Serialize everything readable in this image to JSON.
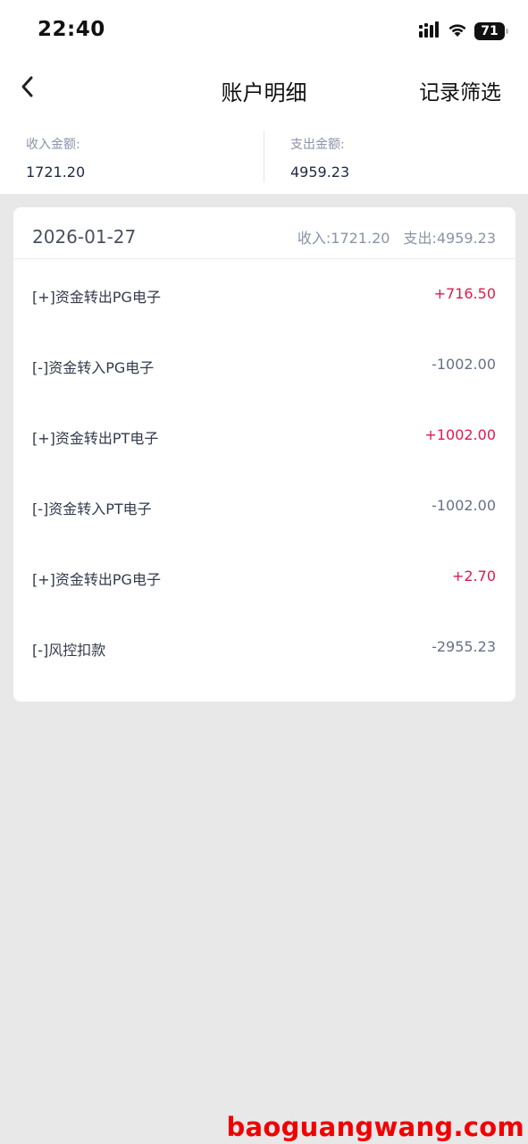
{
  "status_bar": {
    "time": "22:40",
    "battery": "71",
    "icons": [
      "signal-icon",
      "wifi-icon",
      "battery-icon"
    ]
  },
  "nav": {
    "back_icon": "chevron-left-icon",
    "title": "账户明细",
    "filter_label": "记录筛选"
  },
  "summary": {
    "income_label": "收入金额:",
    "income_value": "1721.20",
    "expense_label": "支出金额:",
    "expense_value": "4959.23"
  },
  "group": {
    "date": "2026-01-27",
    "income_total": "收入:1721.20",
    "expense_total": "支出:4959.23",
    "records": [
      {
        "label": "[+]资金转出PG电子",
        "amount": "+716.50",
        "type": "pos"
      },
      {
        "label": "[-]资金转入PG电子",
        "amount": "-1002.00",
        "type": "neg"
      },
      {
        "label": "[+]资金转出PT电子",
        "amount": "+1002.00",
        "type": "pos"
      },
      {
        "label": "[-]资金转入PT电子",
        "amount": "-1002.00",
        "type": "neg"
      },
      {
        "label": "[+]资金转出PG电子",
        "amount": "+2.70",
        "type": "pos"
      },
      {
        "label": "[-]风控扣款",
        "amount": "-2955.23",
        "type": "neg"
      }
    ]
  },
  "colors": {
    "positive": "#dd1a4b",
    "negative": "#667089",
    "background": "#e8e8e8"
  },
  "watermark": "baoguangwang.com"
}
